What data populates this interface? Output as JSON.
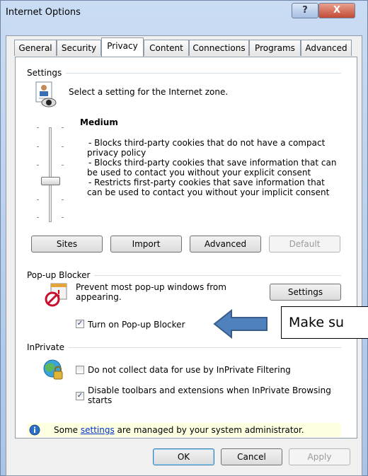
{
  "window": {
    "title": "Internet Options",
    "help_label": "?",
    "close_label": "X"
  },
  "tabs": [
    {
      "label": "General"
    },
    {
      "label": "Security"
    },
    {
      "label": "Privacy"
    },
    {
      "label": "Content"
    },
    {
      "label": "Connections"
    },
    {
      "label": "Programs"
    },
    {
      "label": "Advanced"
    }
  ],
  "settings": {
    "group_label": "Settings",
    "instruction": "Select a setting for the Internet zone.",
    "level": "Medium",
    "description": [
      "- Blocks third-party cookies that do not have a compact",
      "privacy policy",
      "- Blocks third-party cookies that save information that can",
      "be used to contact you without your explicit consent",
      "- Restricts first-party cookies that save information that",
      "can be used to contact you without your implicit consent"
    ],
    "buttons": {
      "sites": "Sites",
      "import": "Import",
      "advanced": "Advanced",
      "default": "Default"
    }
  },
  "popup": {
    "group_label": "Pop-up Blocker",
    "text_line1": "Prevent most pop-up windows from",
    "text_line2": "appearing.",
    "settings_button": "Settings",
    "checkbox_label": "Turn on Pop-up Blocker",
    "checked": true
  },
  "inprivate": {
    "group_label": "InPrivate",
    "option1_label": "Do not collect data for use by InPrivate Filtering",
    "option1_checked": false,
    "option2_line1": "Disable toolbars and extensions when InPrivate Browsing",
    "option2_line2": "starts",
    "option2_checked": true
  },
  "info": {
    "prefix": "Some ",
    "link": "settings",
    "suffix": " are managed by your system administrator."
  },
  "footer": {
    "ok": "OK",
    "cancel": "Cancel",
    "apply": "Apply"
  },
  "annotation": {
    "text": "Make su"
  },
  "colors": {
    "arrow": "#4f81bd",
    "arrow_border": "#385d8a",
    "infobar": "#ffffe1"
  }
}
